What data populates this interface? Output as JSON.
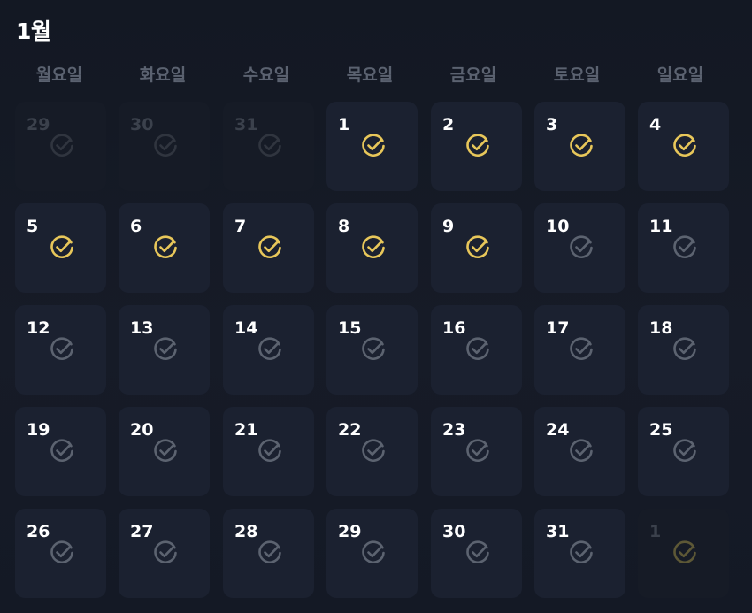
{
  "month": {
    "title": "1월"
  },
  "weekdays": [
    "월요일",
    "화요일",
    "수요일",
    "목요일",
    "금요일",
    "토요일",
    "일요일"
  ],
  "colors": {
    "checked": "#e8c75a",
    "unchecked": "#5c6370",
    "faded_unchecked": "#30353f",
    "faded_checked": "#5d5836"
  },
  "weeks": [
    [
      {
        "day": "29",
        "state": "unchecked",
        "in_month": false
      },
      {
        "day": "30",
        "state": "unchecked",
        "in_month": false
      },
      {
        "day": "31",
        "state": "unchecked",
        "in_month": false
      },
      {
        "day": "1",
        "state": "checked",
        "in_month": true
      },
      {
        "day": "2",
        "state": "checked",
        "in_month": true
      },
      {
        "day": "3",
        "state": "checked",
        "in_month": true
      },
      {
        "day": "4",
        "state": "checked",
        "in_month": true
      }
    ],
    [
      {
        "day": "5",
        "state": "checked",
        "in_month": true
      },
      {
        "day": "6",
        "state": "checked",
        "in_month": true
      },
      {
        "day": "7",
        "state": "checked",
        "in_month": true
      },
      {
        "day": "8",
        "state": "checked",
        "in_month": true
      },
      {
        "day": "9",
        "state": "checked",
        "in_month": true
      },
      {
        "day": "10",
        "state": "unchecked",
        "in_month": true
      },
      {
        "day": "11",
        "state": "unchecked",
        "in_month": true
      }
    ],
    [
      {
        "day": "12",
        "state": "unchecked",
        "in_month": true
      },
      {
        "day": "13",
        "state": "unchecked",
        "in_month": true
      },
      {
        "day": "14",
        "state": "unchecked",
        "in_month": true
      },
      {
        "day": "15",
        "state": "unchecked",
        "in_month": true
      },
      {
        "day": "16",
        "state": "unchecked",
        "in_month": true
      },
      {
        "day": "17",
        "state": "unchecked",
        "in_month": true
      },
      {
        "day": "18",
        "state": "unchecked",
        "in_month": true
      }
    ],
    [
      {
        "day": "19",
        "state": "unchecked",
        "in_month": true
      },
      {
        "day": "20",
        "state": "unchecked",
        "in_month": true
      },
      {
        "day": "21",
        "state": "unchecked",
        "in_month": true
      },
      {
        "day": "22",
        "state": "unchecked",
        "in_month": true
      },
      {
        "day": "23",
        "state": "unchecked",
        "in_month": true
      },
      {
        "day": "24",
        "state": "unchecked",
        "in_month": true
      },
      {
        "day": "25",
        "state": "unchecked",
        "in_month": true
      }
    ],
    [
      {
        "day": "26",
        "state": "unchecked",
        "in_month": true
      },
      {
        "day": "27",
        "state": "unchecked",
        "in_month": true
      },
      {
        "day": "28",
        "state": "unchecked",
        "in_month": true
      },
      {
        "day": "29",
        "state": "unchecked",
        "in_month": true
      },
      {
        "day": "30",
        "state": "unchecked",
        "in_month": true
      },
      {
        "day": "31",
        "state": "unchecked",
        "in_month": true
      },
      {
        "day": "1",
        "state": "checked",
        "in_month": false
      }
    ]
  ]
}
